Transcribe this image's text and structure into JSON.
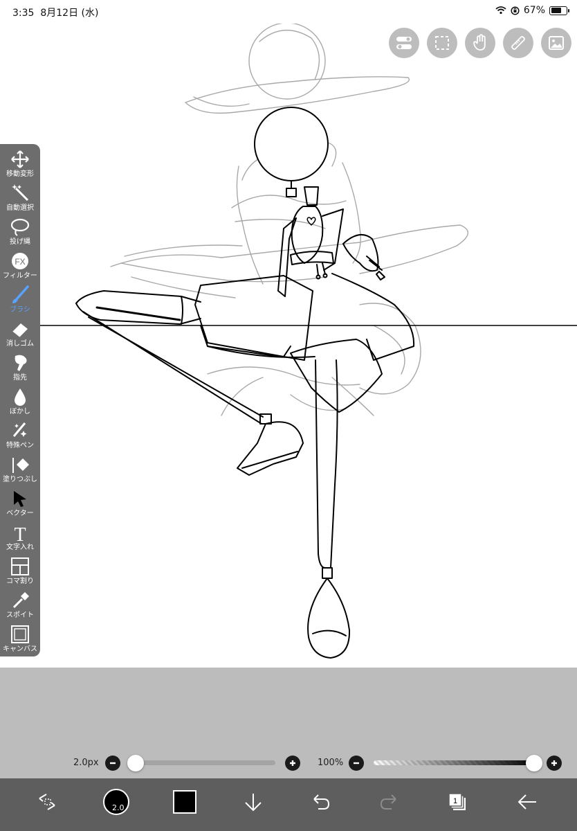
{
  "status_bar": {
    "time": "3:35",
    "date": "8月12日 (水)",
    "battery": "67%",
    "battery_level": 0.67
  },
  "top_tools": [
    {
      "icon": "toggle-icon"
    },
    {
      "icon": "selection-icon"
    },
    {
      "icon": "hand-icon"
    },
    {
      "icon": "ruler-icon"
    },
    {
      "icon": "image-icon"
    }
  ],
  "tools": [
    {
      "label": "移動変形",
      "icon": "move-icon"
    },
    {
      "label": "自動選択",
      "icon": "magic-wand-icon"
    },
    {
      "label": "投げ縄",
      "icon": "lasso-icon"
    },
    {
      "label": "フィルター",
      "icon": "fx-icon",
      "icon_text": "FX"
    },
    {
      "label": "ブラシ",
      "icon": "brush-icon",
      "active": true
    },
    {
      "label": "消しゴム",
      "icon": "eraser-icon"
    },
    {
      "label": "指先",
      "icon": "smudge-icon"
    },
    {
      "label": "ぼかし",
      "icon": "blur-drop-icon"
    },
    {
      "label": "特殊ペン",
      "icon": "special-pen-icon"
    },
    {
      "label": "塗りつぶし",
      "icon": "fill-bucket-icon"
    },
    {
      "label": "ベクター",
      "icon": "vector-cursor-icon"
    },
    {
      "label": "文字入れ",
      "icon": "text-icon",
      "icon_text": "T"
    },
    {
      "label": "コマ割り",
      "icon": "panel-layout-icon"
    },
    {
      "label": "スポイト",
      "icon": "eyedropper-icon"
    },
    {
      "label": "キャンバス",
      "icon": "canvas-icon"
    }
  ],
  "brush_size": {
    "label": "2.0px",
    "level": 0.0
  },
  "opacity": {
    "label": "100%",
    "level": 1.0
  },
  "bottom_bar": {
    "color_button_label": "2.0",
    "layer_count": "1",
    "colors": {
      "primary": "#000000",
      "active_tool": "#5aa2ff"
    }
  }
}
